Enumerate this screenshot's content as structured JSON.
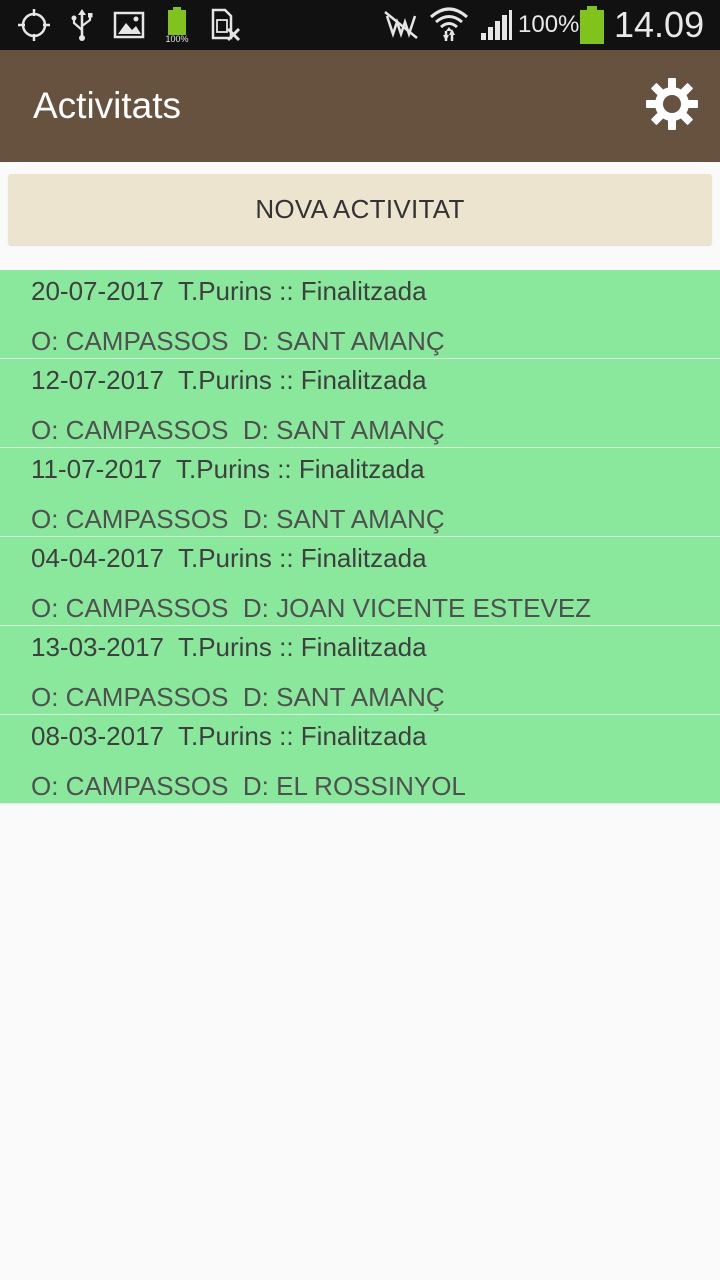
{
  "status_bar": {
    "icons_left": [
      "crosshair-icon",
      "usb-icon",
      "image-icon",
      "battery-full-icon",
      "sim-card-off-icon"
    ],
    "battery_small_label": "100%",
    "icons_right": [
      "mute-icon",
      "wifi-icon",
      "signal-icon"
    ],
    "battery_percent": "100%",
    "clock": "14.09",
    "battery_color": "#7fc31c"
  },
  "action_bar": {
    "title": "Activitats",
    "settings_icon": "gear-icon",
    "background": "#66523f"
  },
  "new_activity_button": {
    "label": "NOVA ACTIVITAT"
  },
  "activities": [
    {
      "date": "20-07-2017",
      "type": "T.Purins",
      "status": "Finalitzada",
      "line1": "20-07-2017  T.Purins :: Finalitzada",
      "line2": "O: CAMPASSOS  D: SANT AMANÇ"
    },
    {
      "date": "12-07-2017",
      "type": "T.Purins",
      "status": "Finalitzada",
      "line1": "12-07-2017  T.Purins :: Finalitzada",
      "line2": "O: CAMPASSOS  D: SANT AMANÇ"
    },
    {
      "date": "11-07-2017",
      "type": "T.Purins",
      "status": "Finalitzada",
      "line1": "11-07-2017  T.Purins :: Finalitzada",
      "line2": "O: CAMPASSOS  D: SANT AMANÇ"
    },
    {
      "date": "04-04-2017",
      "type": "T.Purins",
      "status": "Finalitzada",
      "line1": "04-04-2017  T.Purins :: Finalitzada",
      "line2": "O: CAMPASSOS  D: JOAN VICENTE ESTEVEZ"
    },
    {
      "date": "13-03-2017",
      "type": "T.Purins",
      "status": "Finalitzada",
      "line1": "13-03-2017  T.Purins :: Finalitzada",
      "line2": "O: CAMPASSOS  D: SANT AMANÇ"
    },
    {
      "date": "08-03-2017",
      "type": "T.Purins",
      "status": "Finalitzada",
      "line1": "08-03-2017  T.Purins :: Finalitzada",
      "line2": "O: CAMPASSOS  D: EL ROSSINYOL"
    }
  ],
  "colors": {
    "activity_finished_bg": "#8ae89c",
    "button_bg": "#ede4cf"
  }
}
